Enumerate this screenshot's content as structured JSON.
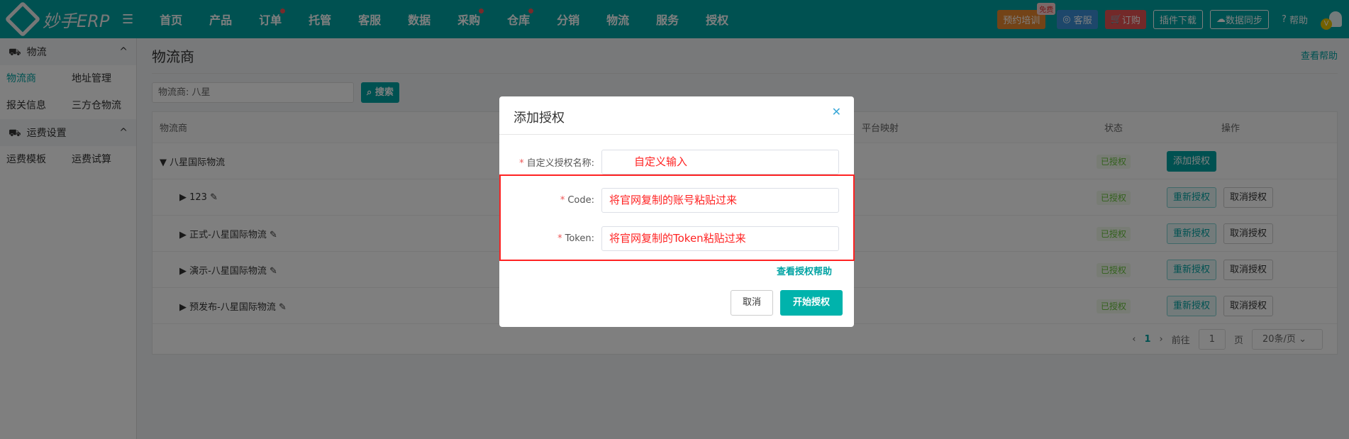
{
  "header": {
    "logo": "妙手ERP",
    "nav": [
      {
        "label": "首页",
        "dot": false
      },
      {
        "label": "产品",
        "dot": false
      },
      {
        "label": "订单",
        "dot": true
      },
      {
        "label": "托管",
        "dot": false
      },
      {
        "label": "客服",
        "dot": false
      },
      {
        "label": "数据",
        "dot": false
      },
      {
        "label": "采购",
        "dot": true
      },
      {
        "label": "仓库",
        "dot": true
      },
      {
        "label": "分销",
        "dot": false
      },
      {
        "label": "物流",
        "dot": false
      },
      {
        "label": "服务",
        "dot": false
      },
      {
        "label": "授权",
        "dot": false
      }
    ],
    "training": "预约培训",
    "training_badge": "免费",
    "service": "客服",
    "order": "订购",
    "plugin": "插件下载",
    "sync": "数据同步",
    "help": "帮助",
    "avatar": "V"
  },
  "sidebar": {
    "groups": [
      {
        "label": "物流",
        "items": [
          "物流商",
          "地址管理",
          "报关信息",
          "三方仓物流"
        ]
      },
      {
        "label": "运费设置",
        "items": [
          "运费模板",
          "运费试算"
        ]
      }
    ]
  },
  "page": {
    "title": "物流商",
    "help": "查看帮助",
    "search_value": "物流商:  八星",
    "search_btn": "搜索"
  },
  "table": {
    "headers": [
      "物流商",
      "平台映射",
      "状态",
      "操作"
    ],
    "rows": [
      {
        "name": "八星国际物流",
        "status": "已授权",
        "actions": [
          "添加授权"
        ]
      },
      {
        "name": "123",
        "status": "已授权",
        "actions": [
          "重新授权",
          "取消授权"
        ]
      },
      {
        "name": "正式-八星国际物流",
        "status": "已授权",
        "actions": [
          "重新授权",
          "取消授权"
        ]
      },
      {
        "name": "演示-八星国际物流",
        "status": "已授权",
        "actions": [
          "重新授权",
          "取消授权"
        ]
      },
      {
        "name": "预发布-八星国际物流",
        "status": "已授权",
        "actions": [
          "重新授权",
          "取消授权"
        ]
      }
    ]
  },
  "pager": {
    "page": "1",
    "goto": "前往",
    "input": "1",
    "unit": "页",
    "size": "20条/页"
  },
  "modal": {
    "title": "添加授权",
    "fields": [
      {
        "label": "自定义授权名称:",
        "value": "自定义输入"
      },
      {
        "label": "Code:",
        "value": "将官网复制的账号粘贴过来"
      },
      {
        "label": "Token:",
        "value": "将官网复制的Token粘贴过来"
      }
    ],
    "help": "查看授权帮助",
    "cancel": "取消",
    "ok": "开始授权"
  }
}
